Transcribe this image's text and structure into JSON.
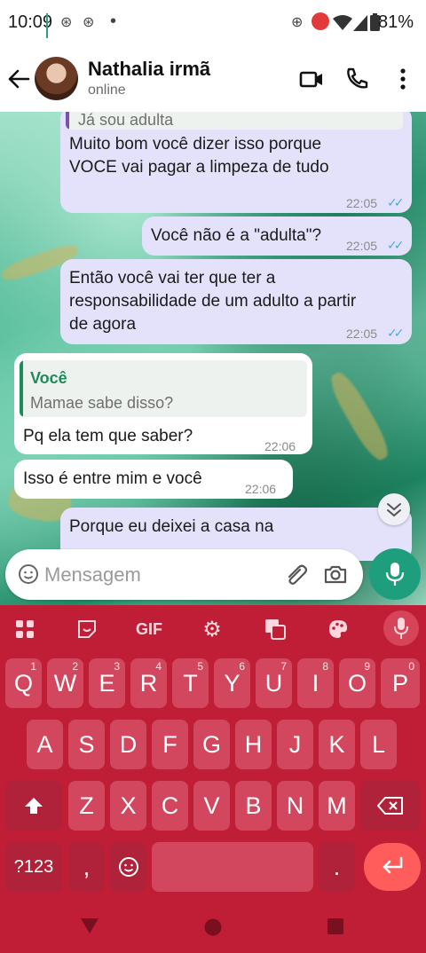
{
  "status_bar": {
    "time": "10:09",
    "battery": "81%"
  },
  "header": {
    "contact_name": "Nathalia irmã",
    "contact_status": "online"
  },
  "messages": [
    {
      "quote_text": "Já sou adulta",
      "line1": "Muito bom você dizer isso porque",
      "line2": "VOCE vai pagar a limpeza de tudo",
      "time": "22:05",
      "direction": "out",
      "status": "read"
    },
    {
      "line1": "Você não é a \"adulta\"?",
      "time": "22:05",
      "direction": "out",
      "status": "read"
    },
    {
      "line1": "Então você vai ter que ter a",
      "line2": "responsabilidade de um adulto a partir",
      "line3": "de agora",
      "time": "22:05",
      "direction": "out",
      "status": "read"
    },
    {
      "quote_author": "Você",
      "quote_text": "Mamae sabe disso?",
      "line1": "Pq ela tem que saber?",
      "time": "22:06",
      "direction": "in"
    },
    {
      "line1": "Isso é entre mim e você",
      "time": "22:06",
      "direction": "in"
    },
    {
      "line1": "Porque eu deixei a casa na",
      "direction": "out",
      "partial": true
    }
  ],
  "composer": {
    "placeholder": "Mensagem"
  },
  "keyboard": {
    "toolbar": {
      "gif": "GIF"
    },
    "row1": [
      {
        "key": "Q",
        "hint": "1"
      },
      {
        "key": "W",
        "hint": "2"
      },
      {
        "key": "E",
        "hint": "3"
      },
      {
        "key": "R",
        "hint": "4"
      },
      {
        "key": "T",
        "hint": "5"
      },
      {
        "key": "Y",
        "hint": "6"
      },
      {
        "key": "U",
        "hint": "7"
      },
      {
        "key": "I",
        "hint": "8"
      },
      {
        "key": "O",
        "hint": "9"
      },
      {
        "key": "P",
        "hint": "0"
      }
    ],
    "row2": [
      "A",
      "S",
      "D",
      "F",
      "G",
      "H",
      "J",
      "K",
      "L"
    ],
    "row3": [
      "Z",
      "X",
      "C",
      "V",
      "B",
      "N",
      "M"
    ],
    "symbols_label": "?123",
    "comma": ",",
    "period": "."
  },
  "colors": {
    "outgoing_bubble": "#e4e2fa",
    "incoming_bubble": "#ffffff",
    "accent": "#1f9e7d",
    "keyboard": "#c01e37",
    "read_ticks": "#4fa6e8"
  }
}
